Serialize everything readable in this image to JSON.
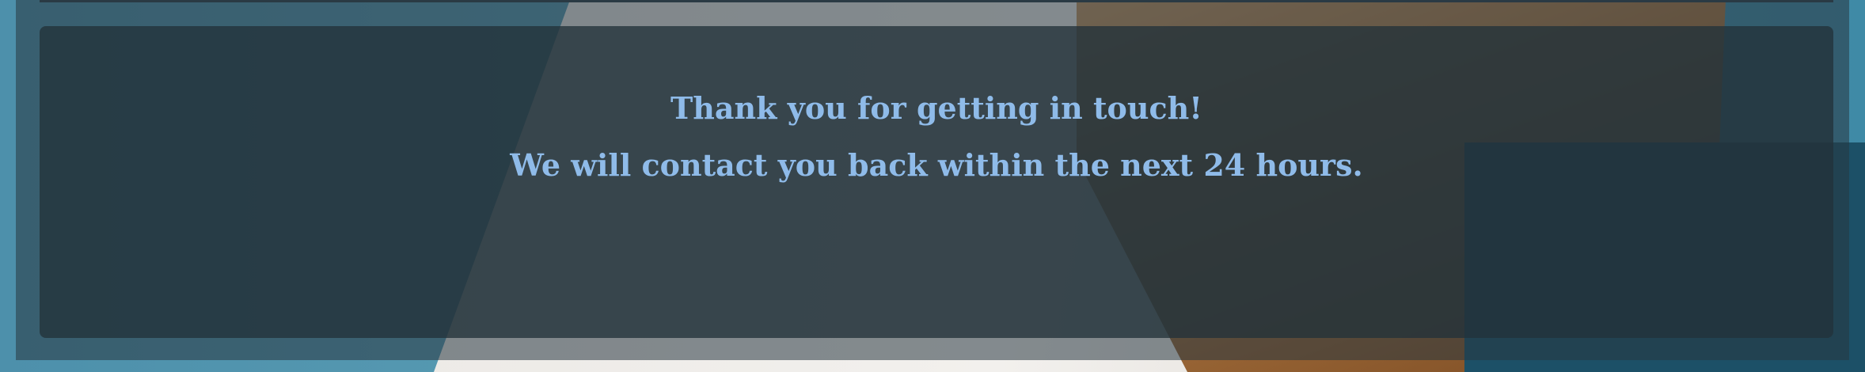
{
  "background": {
    "description_icon": "house-photo-background"
  },
  "confirmation": {
    "line1": "Thank you for getting in touch!",
    "line2": "We will contact you back within the next 24 hours."
  },
  "colors": {
    "text": "#8fbbe9",
    "panel": "#23323a"
  }
}
